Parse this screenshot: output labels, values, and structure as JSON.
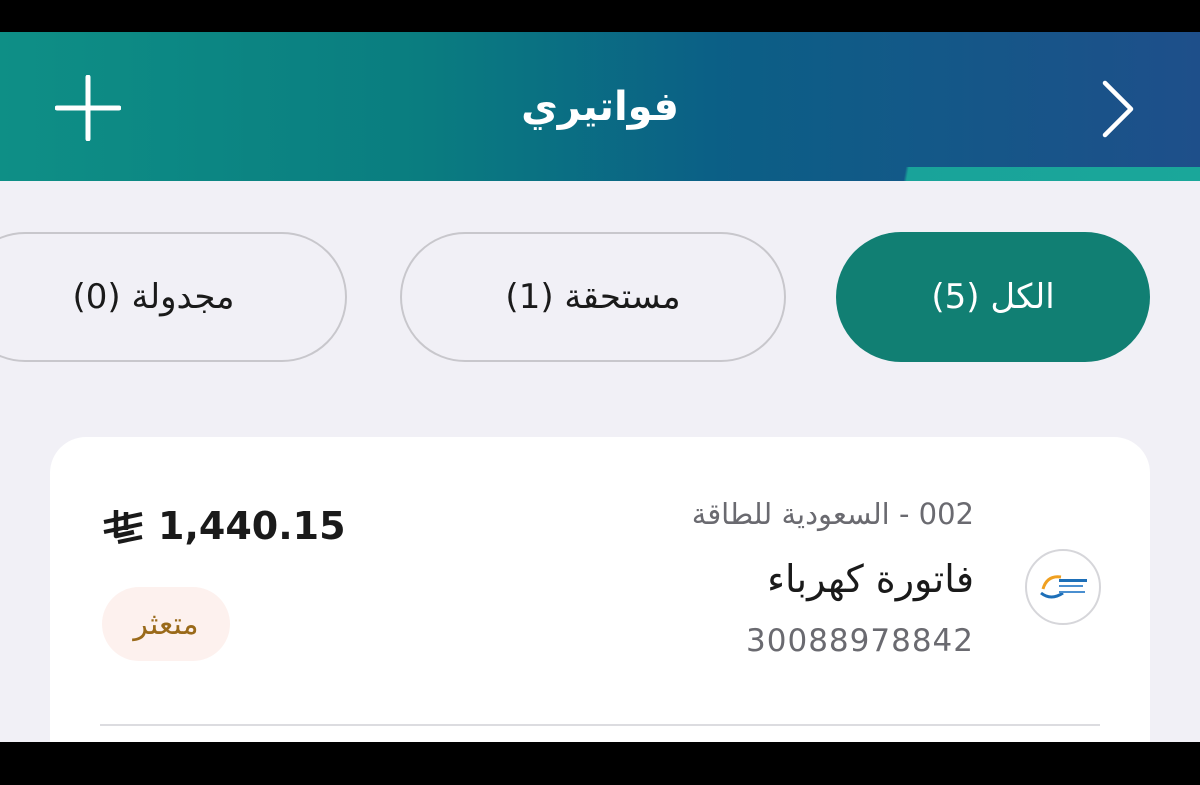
{
  "header": {
    "title": "فواتيري",
    "add_icon": "plus-icon",
    "back_icon": "chevron-right-icon"
  },
  "tabs": [
    {
      "label": "الكل (5)",
      "selected": true
    },
    {
      "label": "مستحقة (1)",
      "selected": false
    },
    {
      "label": "مجدولة (0)",
      "selected": false
    }
  ],
  "bill": {
    "provider": "002 - السعودية للطاقة",
    "name": "فاتورة كهرباء",
    "account_number": "30088978842",
    "amount": "1,440.15",
    "currency_icon": "saudi-riyal-icon",
    "status": "متعثر",
    "logo": "saudi-electricity-logo"
  },
  "colors": {
    "accent": "#117f73",
    "header_start": "#0e8f86",
    "header_end": "#1e4f8a",
    "status_text": "#9a6a1a",
    "status_bg": "#fdf1ee"
  }
}
